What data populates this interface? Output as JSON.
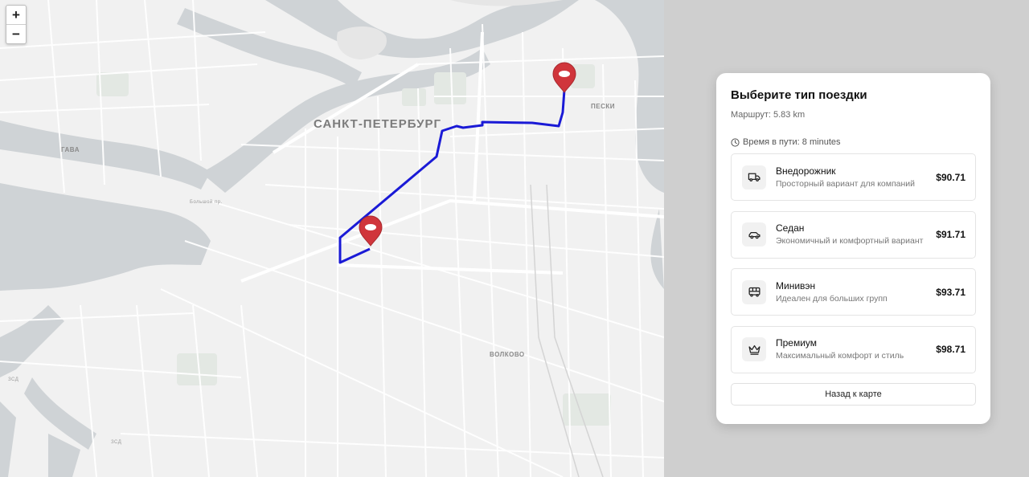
{
  "map": {
    "zoom_in_label": "+",
    "zoom_out_label": "−",
    "labels": {
      "city": "САНКТ-ПЕТЕРБУРГ",
      "peski": "ПЕСКИ",
      "gava": "ГАВА",
      "volkovo": "ВОЛКОВО",
      "bolshoy": "Большой пр.",
      "scd1": "ЗСД",
      "scd2": "ЗСД"
    },
    "route_color": "#1a1ad6",
    "marker_color": "#d0353b"
  },
  "panel": {
    "title": "Выберите тип поездки",
    "route_text": "Маршрут: 5.83 km",
    "eta_text": "Время в пути: 8 minutes",
    "options": [
      {
        "icon": "truck-icon",
        "name": "Внедорожник",
        "desc": "Просторный вариант для компаний",
        "price": "$90.71"
      },
      {
        "icon": "car-icon",
        "name": "Седан",
        "desc": "Экономичный и комфортный вариант",
        "price": "$91.71"
      },
      {
        "icon": "bus-icon",
        "name": "Минивэн",
        "desc": "Идеален для больших групп",
        "price": "$93.71"
      },
      {
        "icon": "crown-icon",
        "name": "Премиум",
        "desc": "Максимальный комфорт и стиль",
        "price": "$98.71"
      }
    ],
    "back_label": "Назад к карте"
  }
}
